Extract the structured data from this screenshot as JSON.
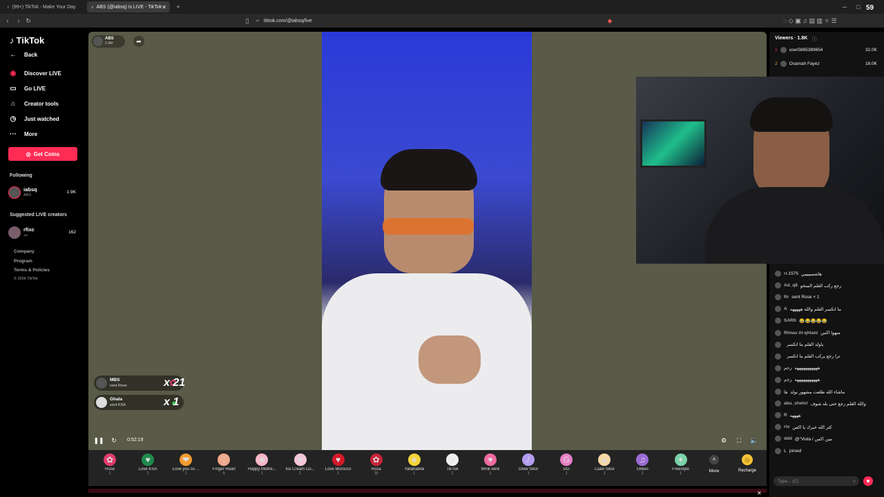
{
  "browser": {
    "tabs": [
      {
        "label": "(99+) TikTok - Make Your Day"
      },
      {
        "label": "ABS (@iabsq) is LIVE - TikTok"
      }
    ],
    "url": "tiktok.com/@iabsq/live",
    "frame_counter": "59"
  },
  "sidebar": {
    "logo": "TikTok",
    "back": "Back",
    "nav": [
      {
        "label": "Discover LIVE",
        "icon": "live-icon"
      },
      {
        "label": "Go LIVE",
        "icon": "camera-icon"
      },
      {
        "label": "Creator tools",
        "icon": "home-icon"
      },
      {
        "label": "Just watched",
        "icon": "clock-icon"
      },
      {
        "label": "More",
        "icon": "dots-icon"
      }
    ],
    "coins_button": "Get Coins",
    "following_title": "Following",
    "following": [
      {
        "name": "iabsq",
        "sub": "ABS",
        "count": "1.9K"
      }
    ],
    "suggested_title": "Suggested LIVE creators",
    "suggested": [
      {
        "name": "rfixc",
        "sub": "حذ",
        "count": "162"
      }
    ],
    "footer": [
      "Company",
      "Program",
      "Terms & Policies",
      "© 2026 TikTok"
    ]
  },
  "stream": {
    "host_name": "ABS",
    "host_likes": "2.4M",
    "timer": "0:52:19",
    "notifications": [
      {
        "name": "MBS",
        "action": "sent Rose",
        "mult": "x 21"
      },
      {
        "name": "Ghala",
        "action": "sent KSA",
        "mult": "x 1"
      }
    ]
  },
  "gifts": [
    {
      "name": "Rose",
      "price": "1",
      "color": "#e23c6a",
      "glyph": "✿"
    },
    {
      "name": "Love KSA",
      "price": "1",
      "color": "#1f8a4c",
      "glyph": "♥"
    },
    {
      "name": "Love you so ...",
      "price": "1",
      "color": "#f29b2f",
      "glyph": "❤"
    },
    {
      "name": "Finger Heart",
      "price": "5",
      "color": "#f0a88b",
      "glyph": "♡"
    },
    {
      "name": "Happy Mothe...",
      "price": "1",
      "color": "#f7b6c8",
      "glyph": "❀"
    },
    {
      "name": "Ice Cream Co...",
      "price": "1",
      "color": "#f3c6d9",
      "glyph": "▼"
    },
    {
      "name": "Love Morocco",
      "price": "1",
      "color": "#d3192a",
      "glyph": "♥"
    },
    {
      "name": "Rosa",
      "price": "10",
      "color": "#c8243a",
      "glyph": "✿"
    },
    {
      "name": "Yallahabibi",
      "price": "1",
      "color": "#f3d43a",
      "glyph": "★"
    },
    {
      "name": "TikTok",
      "price": "1",
      "color": "#eeeeee",
      "glyph": "♪"
    },
    {
      "name": "Wink wink",
      "price": "1",
      "color": "#ef6aa0",
      "glyph": "♥"
    },
    {
      "name": "Glow Stick",
      "price": "1",
      "color": "#b59cf0",
      "glyph": "/"
    },
    {
      "name": "GG",
      "price": "1",
      "color": "#e87fc7",
      "glyph": "G"
    },
    {
      "name": "Cake Slice",
      "price": "1",
      "color": "#f7d8a6",
      "glyph": "▲"
    },
    {
      "name": "Oldies",
      "price": "1",
      "color": "#9a6bd6",
      "glyph": "♫"
    },
    {
      "name": "Freestyle",
      "price": "1",
      "color": "#7bd1a8",
      "glyph": "✦"
    }
  ],
  "gift_more": "More",
  "recharge": "Recharge",
  "viewers": {
    "title": "Viewers · 1.8K",
    "list": [
      {
        "rank": "1",
        "name": "user5865389654",
        "score": "32.0K"
      },
      {
        "rank": "2",
        "name": "Osamah Fayez",
        "score": "18.0K"
      }
    ]
  },
  "chat": [
    {
      "name": "rr.1575",
      "text": "هاشميييييي"
    },
    {
      "name": "Ad_q8",
      "text": "رجع ركب القلم السخو"
    },
    {
      "name": "Rr",
      "text": "sent Rose × 1"
    },
    {
      "name": "A",
      "text": "ما انكسر القلم والله هههههه"
    },
    {
      "name": "SARK",
      "text": "😂😂😂😂😂"
    },
    {
      "name": "Rimas Al-qhtani",
      "text": "منهوا اكس"
    },
    {
      "name": "",
      "text": "ياولد القلم ما انكسر"
    },
    {
      "name": "",
      "text": "ترا رجع يركب القلم ما انكسر"
    },
    {
      "name": "رحم",
      "text": "هههههههههههه"
    },
    {
      "name": "رحم",
      "text": "هههههههههههه"
    },
    {
      "name": "ها",
      "text": "ماشاء الله طلعت مشهور بولد"
    },
    {
      "name": "abu_shehri",
      "text": "والله القلم رجع حتى بله شوف"
    },
    {
      "name": "R",
      "text": "ههههه"
    },
    {
      "name": "rio",
      "text": "كثر الله خيرك يا اكس"
    },
    {
      "name": "ddd",
      "text": "@\"Viola / مين اكس"
    },
    {
      "name": "L",
      "text": "joined"
    }
  ],
  "chat_input_placeholder": "Type... (C)"
}
